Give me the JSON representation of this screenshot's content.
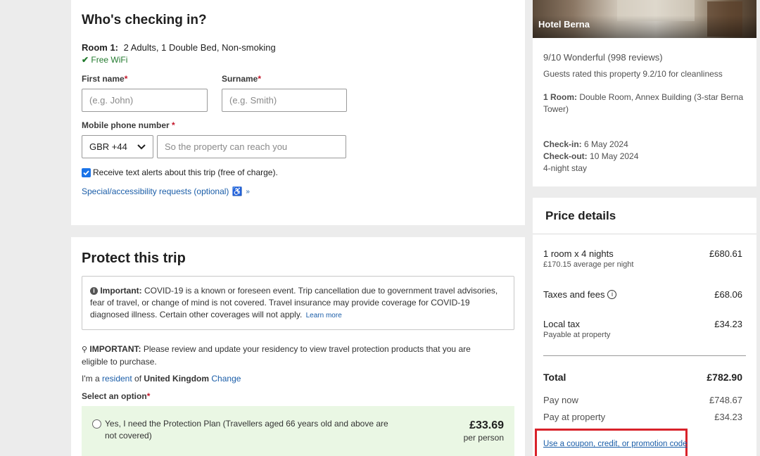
{
  "checkin": {
    "title": "Who's checking in?",
    "room_label": "Room 1:",
    "room_desc": "2 Adults, 1 Double Bed, Non-smoking",
    "free_wifi": "Free WiFi",
    "first_name_label": "First name",
    "first_name_placeholder": "(e.g. John)",
    "surname_label": "Surname",
    "surname_placeholder": "(e.g. Smith)",
    "phone_label": "Mobile phone number",
    "country_code": "GBR +44",
    "phone_placeholder": "So the property can reach you",
    "text_alerts": "Receive text alerts about this trip (free of charge).",
    "text_alerts_checked": true,
    "special_requests": "Special/accessibility requests (optional)"
  },
  "protect": {
    "title": "Protect this trip",
    "important_label": "Important:",
    "important_text": "COVID-19 is a known or foreseen event. Trip cancellation due to government travel advisories, fear of travel, or change of mind is not covered. Travel insurance may provide coverage for COVID-19 diagnosed illness. Certain other coverages will not apply.",
    "learn_more": "Learn more",
    "residency_label": "IMPORTANT:",
    "residency_text": "Please review and update your residency to view travel protection products that you are eligible to purchase.",
    "resident_prefix": "I'm a",
    "resident_link": "resident",
    "resident_of": "of",
    "resident_country": "United Kingdom",
    "change_link": "Change",
    "select_option_label": "Select an option",
    "option_yes_text": "Yes, I need the Protection Plan (Travellers aged 66 years old and above are not covered)",
    "option_yes_price": "£33.69",
    "option_yes_per": "per person"
  },
  "hotel": {
    "name": "Hotel Berna",
    "rating": "9/10 Wonderful (998 reviews)",
    "cleanliness": "Guests rated this property 9.2/10 for cleanliness",
    "room_label": "1 Room:",
    "room_text": "Double Room, Annex Building (3-star Berna Tower)",
    "checkin_label": "Check-in:",
    "checkin_date": "6 May 2024",
    "checkout_label": "Check-out:",
    "checkout_date": "10 May 2024",
    "stay": "4-night stay"
  },
  "price": {
    "title": "Price details",
    "rooms_label": "1 room x 4 nights",
    "rooms_sub": "£170.15 average per night",
    "rooms_value": "£680.61",
    "taxes_label": "Taxes and fees",
    "taxes_value": "£68.06",
    "local_tax_label": "Local tax",
    "local_tax_sub": "Payable at property",
    "local_tax_value": "£34.23",
    "total_label": "Total",
    "total_value": "£782.90",
    "pay_now_label": "Pay now",
    "pay_now_value": "£748.67",
    "pay_property_label": "Pay at property",
    "pay_property_value": "£34.23",
    "coupon_link": "Use a coupon, credit, or promotion code"
  },
  "colors": {
    "link": "#1a5da8",
    "green": "#227a2e",
    "option_bg": "#eaf7e4",
    "highlight": "#d9222a"
  }
}
